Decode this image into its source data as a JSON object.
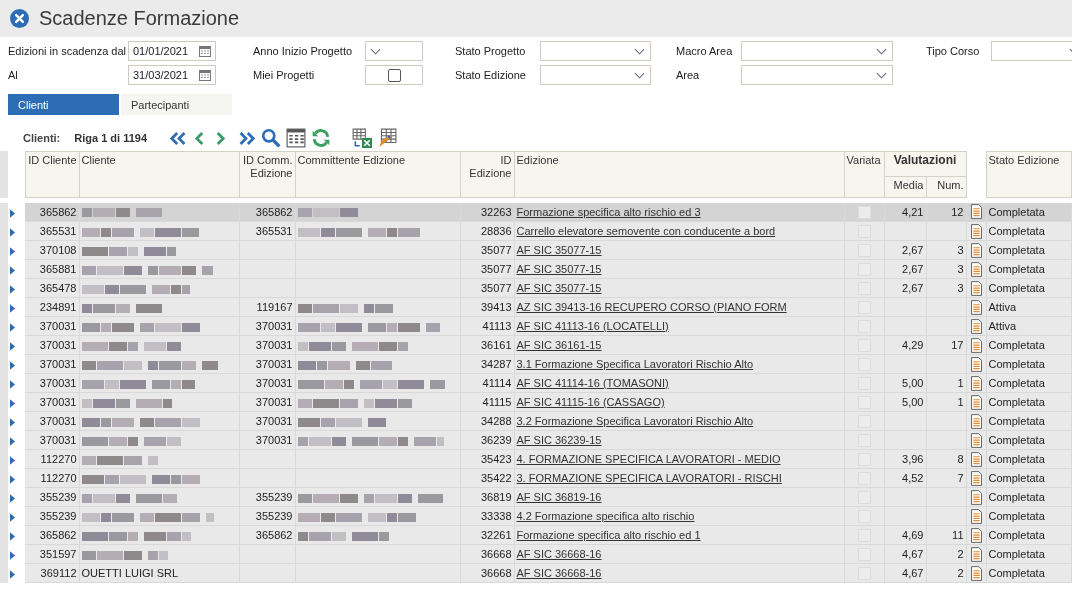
{
  "window": {
    "title": "Scadenze Formazione"
  },
  "filter_rows": [
    [
      {
        "kind": "date",
        "label": "Edizioni in scadenza dal",
        "value": "01/01/2021"
      },
      {
        "kind": "select",
        "label": "Anno Inizio Progetto"
      },
      {
        "kind": "select",
        "label": "Stato Progetto"
      },
      {
        "kind": "select",
        "label": "Macro Area"
      },
      {
        "kind": "select",
        "label": "Tipo Corso"
      }
    ],
    [
      {
        "kind": "date",
        "label": "Al",
        "value": "31/03/2021"
      },
      {
        "kind": "checkbox",
        "label": "Miei Progetti",
        "checked": false
      },
      {
        "kind": "select",
        "label": "Stato Edizione"
      },
      {
        "kind": "select",
        "label": "Area"
      }
    ]
  ],
  "tabs": [
    {
      "label": "Clienti",
      "selected": true
    },
    {
      "label": "Partecipanti",
      "selected": false
    }
  ],
  "toolbar": {
    "label": "Clienti:",
    "position": "Riga 1 di 1194"
  },
  "table": {
    "columns": {
      "id_cliente": "ID Cliente",
      "cliente": "Cliente",
      "id_comm_1": "ID Comm.",
      "id_comm_2": "Edizione",
      "committente": "Committente Edizione",
      "id_edizione_1": "ID",
      "id_edizione_2": "Edizione",
      "edizione": "Edizione",
      "variata": "Variata",
      "valutazioni": "Valutazioni",
      "media": "Media",
      "num": "Num.",
      "stato": "Stato Edizione"
    },
    "rows": [
      {
        "selected": true,
        "id_cliente": "365862",
        "cliente_blurred": true,
        "id_comm": "365862",
        "committente_blurred": true,
        "id_edizione": "32263",
        "edizione": "Formazione specifica alto rischio ed 3",
        "variata": false,
        "media": "4,21",
        "num": "12",
        "stato": "Completata"
      },
      {
        "selected": false,
        "id_cliente": "365531",
        "cliente_blurred": true,
        "id_comm": "365531",
        "committente_blurred": true,
        "id_edizione": "28836",
        "edizione": "Carrello elevatore semovente con conducente a bord",
        "variata": false,
        "stato": "Completata"
      },
      {
        "selected": false,
        "id_cliente": "370108",
        "cliente_blurred": true,
        "id_edizione": "35077",
        "edizione": "AF SIC 35077-15",
        "variata": false,
        "media": "2,67",
        "num": "3",
        "stato": "Completata"
      },
      {
        "selected": false,
        "id_cliente": "365881",
        "cliente_blurred": true,
        "id_edizione": "35077",
        "edizione": "AF SIC 35077-15",
        "variata": false,
        "media": "2,67",
        "num": "3",
        "stato": "Completata"
      },
      {
        "selected": false,
        "id_cliente": "365478",
        "cliente_blurred": true,
        "id_edizione": "35077",
        "edizione": "AF SIC 35077-15",
        "variata": false,
        "media": "2,67",
        "num": "3",
        "stato": "Completata"
      },
      {
        "selected": false,
        "id_cliente": "234891",
        "cliente_blurred": true,
        "id_comm": "119167",
        "committente_blurred": true,
        "id_edizione": "39413",
        "edizione": "AZ SIC 39413-16 RECUPERO CORSO (PIANO FORM",
        "variata": false,
        "stato": "Attiva"
      },
      {
        "selected": false,
        "id_cliente": "370031",
        "cliente_blurred": true,
        "id_comm": "370031",
        "committente_blurred": true,
        "id_edizione": "41113",
        "edizione": "AF SIC 41113-16 (LOCATELLI)",
        "variata": false,
        "stato": "Attiva"
      },
      {
        "selected": false,
        "id_cliente": "370031",
        "cliente_blurred": true,
        "id_comm": "370031",
        "committente_blurred": true,
        "id_edizione": "36161",
        "edizione": "AF SIC 36161-15",
        "variata": false,
        "media": "4,29",
        "num": "17",
        "stato": "Completata"
      },
      {
        "selected": false,
        "id_cliente": "370031",
        "cliente_blurred": true,
        "id_comm": "370031",
        "committente_blurred": true,
        "id_edizione": "34287",
        "edizione": "3.1 Formazione Specifica Lavoratori Rischio Alto",
        "variata": false,
        "stato": "Completata"
      },
      {
        "selected": false,
        "id_cliente": "370031",
        "cliente_blurred": true,
        "id_comm": "370031",
        "committente_blurred": true,
        "id_edizione": "41114",
        "edizione": "AF SIC 41114-16 (TOMASONI)",
        "variata": false,
        "media": "5,00",
        "num": "1",
        "stato": "Completata"
      },
      {
        "selected": false,
        "id_cliente": "370031",
        "cliente_blurred": true,
        "id_comm": "370031",
        "committente_blurred": true,
        "id_edizione": "41115",
        "edizione": "AF SIC 41115-16 (CASSAGO)",
        "variata": false,
        "media": "5,00",
        "num": "1",
        "stato": "Completata"
      },
      {
        "selected": false,
        "id_cliente": "370031",
        "cliente_blurred": true,
        "id_comm": "370031",
        "committente_blurred": true,
        "id_edizione": "34288",
        "edizione": "3.2 Formazione Specifica Lavoratori Rischio Alto",
        "variata": false,
        "stato": "Completata"
      },
      {
        "selected": false,
        "id_cliente": "370031",
        "cliente_blurred": true,
        "id_comm": "370031",
        "committente_blurred": true,
        "id_edizione": "36239",
        "edizione": "AF SIC 36239-15",
        "variata": false,
        "stato": "Completata"
      },
      {
        "selected": false,
        "id_cliente": "112270",
        "cliente_blurred": true,
        "id_edizione": "35423",
        "edizione": "4. FORMAZIONE SPECIFICA LAVORATORI - MEDIO",
        "variata": false,
        "media": "3,96",
        "num": "8",
        "stato": "Completata"
      },
      {
        "selected": false,
        "id_cliente": "112270",
        "cliente_blurred": true,
        "id_edizione": "35422",
        "edizione": "3. FORMAZIONE SPECIFICA LAVORATORI - RISCHI",
        "variata": false,
        "media": "4,52",
        "num": "7",
        "stato": "Completata"
      },
      {
        "selected": false,
        "id_cliente": "355239",
        "cliente_blurred": true,
        "id_comm": "355239",
        "committente_blurred": true,
        "id_edizione": "36819",
        "edizione": "AF SIC 36819-16",
        "variata": false,
        "stato": "Completata"
      },
      {
        "selected": false,
        "id_cliente": "355239",
        "cliente_blurred": true,
        "id_comm": "355239",
        "committente_blurred": true,
        "id_edizione": "33338",
        "edizione": "4.2 Formazione specifica alto rischio",
        "variata": false,
        "stato": "Completata"
      },
      {
        "selected": false,
        "id_cliente": "365862",
        "cliente_blurred": true,
        "id_comm": "365862",
        "committente_blurred": true,
        "id_edizione": "32261",
        "edizione": "Formazione specifica alto rischio ed 1",
        "variata": false,
        "media": "4,69",
        "num": "11",
        "stato": "Completata"
      },
      {
        "selected": false,
        "id_cliente": "351597",
        "cliente_blurred": true,
        "id_edizione": "36668",
        "edizione": "AF SIC 36668-16",
        "variata": false,
        "media": "4,67",
        "num": "2",
        "stato": "Completata"
      },
      {
        "selected": false,
        "id_cliente": "369112",
        "cliente": "OUETTI LUIGI SRL",
        "id_edizione": "36668",
        "edizione": "AF SIC 36668-16",
        "variata": false,
        "media": "4,67",
        "num": "2",
        "stato": "Completata"
      }
    ]
  }
}
